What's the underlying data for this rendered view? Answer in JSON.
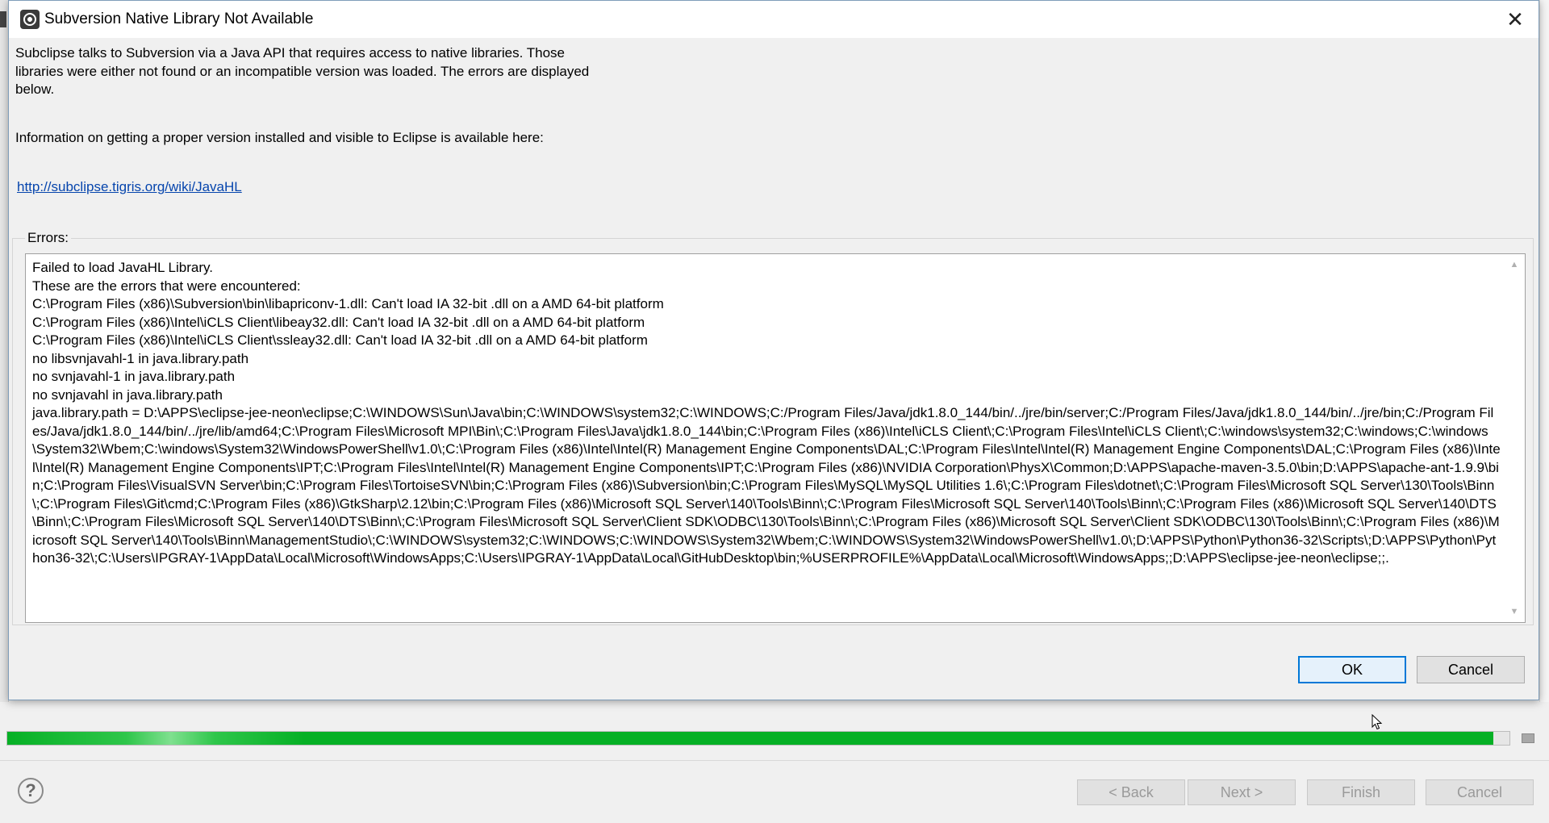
{
  "dialog": {
    "title": "Subversion Native Library Not Available",
    "close_glyph": "✕",
    "message": "Subclipse talks to Subversion via a Java API that requires access to native libraries.  Those\nlibraries were either not found or an incompatible version was loaded.  The errors are displayed\nbelow.",
    "info": "Information on getting a proper version installed and visible to Eclipse is available here:",
    "link": "http://subclipse.tigris.org/wiki/JavaHL",
    "errors_label": "Errors:",
    "errors_text": "Failed to load JavaHL Library.\nThese are the errors that were encountered:\nC:\\Program Files (x86)\\Subversion\\bin\\libapriconv-1.dll: Can't load IA 32-bit .dll on a AMD 64-bit platform\nC:\\Program Files (x86)\\Intel\\iCLS Client\\libeay32.dll: Can't load IA 32-bit .dll on a AMD 64-bit platform\nC:\\Program Files (x86)\\Intel\\iCLS Client\\ssleay32.dll: Can't load IA 32-bit .dll on a AMD 64-bit platform\nno libsvnjavahl-1 in java.library.path\nno svnjavahl-1 in java.library.path\nno svnjavahl in java.library.path\njava.library.path = D:\\APPS\\eclipse-jee-neon\\eclipse;C:\\WINDOWS\\Sun\\Java\\bin;C:\\WINDOWS\\system32;C:\\WINDOWS;C:/Program Files/Java/jdk1.8.0_144/bin/../jre/bin/server;C:/Program Files/Java/jdk1.8.0_144/bin/../jre/bin;C:/Program Files/Java/jdk1.8.0_144/bin/../jre/lib/amd64;C:\\Program Files\\Microsoft MPI\\Bin\\;C:\\Program Files\\Java\\jdk1.8.0_144\\bin;C:\\Program Files (x86)\\Intel\\iCLS Client\\;C:\\Program Files\\Intel\\iCLS Client\\;C:\\windows\\system32;C:\\windows;C:\\windows\\System32\\Wbem;C:\\windows\\System32\\WindowsPowerShell\\v1.0\\;C:\\Program Files (x86)\\Intel\\Intel(R) Management Engine Components\\DAL;C:\\Program Files\\Intel\\Intel(R) Management Engine Components\\DAL;C:\\Program Files (x86)\\Intel\\Intel(R) Management Engine Components\\IPT;C:\\Program Files\\Intel\\Intel(R) Management Engine Components\\IPT;C:\\Program Files (x86)\\NVIDIA Corporation\\PhysX\\Common;D:\\APPS\\apache-maven-3.5.0\\bin;D:\\APPS\\apache-ant-1.9.9\\bin;C:\\Program Files\\VisualSVN Server\\bin;C:\\Program Files\\TortoiseSVN\\bin;C:\\Program Files (x86)\\Subversion\\bin;C:\\Program Files\\MySQL\\MySQL Utilities 1.6\\;C:\\Program Files\\dotnet\\;C:\\Program Files\\Microsoft SQL Server\\130\\Tools\\Binn\\;C:\\Program Files\\Git\\cmd;C:\\Program Files (x86)\\GtkSharp\\2.12\\bin;C:\\Program Files (x86)\\Microsoft SQL Server\\140\\Tools\\Binn\\;C:\\Program Files\\Microsoft SQL Server\\140\\Tools\\Binn\\;C:\\Program Files (x86)\\Microsoft SQL Server\\140\\DTS\\Binn\\;C:\\Program Files\\Microsoft SQL Server\\140\\DTS\\Binn\\;C:\\Program Files\\Microsoft SQL Server\\Client SDK\\ODBC\\130\\Tools\\Binn\\;C:\\Program Files (x86)\\Microsoft SQL Server\\Client SDK\\ODBC\\130\\Tools\\Binn\\;C:\\Program Files (x86)\\Microsoft SQL Server\\140\\Tools\\Binn\\ManagementStudio\\;C:\\WINDOWS\\system32;C:\\WINDOWS;C:\\WINDOWS\\System32\\Wbem;C:\\WINDOWS\\System32\\WindowsPowerShell\\v1.0\\;D:\\APPS\\Python\\Python36-32\\Scripts\\;D:\\APPS\\Python\\Python36-32\\;C:\\Users\\IPGRAY-1\\AppData\\Local\\Microsoft\\WindowsApps;C:\\Users\\IPGRAY-1\\AppData\\Local\\GitHubDesktop\\bin;%USERPROFILE%\\AppData\\Local\\Microsoft\\WindowsApps;;D:\\APPS\\eclipse-jee-neon\\eclipse;;.",
    "ok_label": "OK",
    "cancel_label": "Cancel"
  },
  "wizard": {
    "progress_fraction": 0.989,
    "help_glyph": "?",
    "back_label": "< Back",
    "next_label": "Next >",
    "finish_label": "Finish",
    "cancel_label": "Cancel"
  },
  "colors": {
    "progress_green": "#06b025",
    "link_blue": "#0645ad",
    "ok_border": "#0078d7"
  },
  "icons": {
    "title_icon": "eclipse-icon",
    "close": "close-icon",
    "help": "help-icon",
    "stop": "stop-icon",
    "cursor": "mouse-pointer-icon"
  }
}
